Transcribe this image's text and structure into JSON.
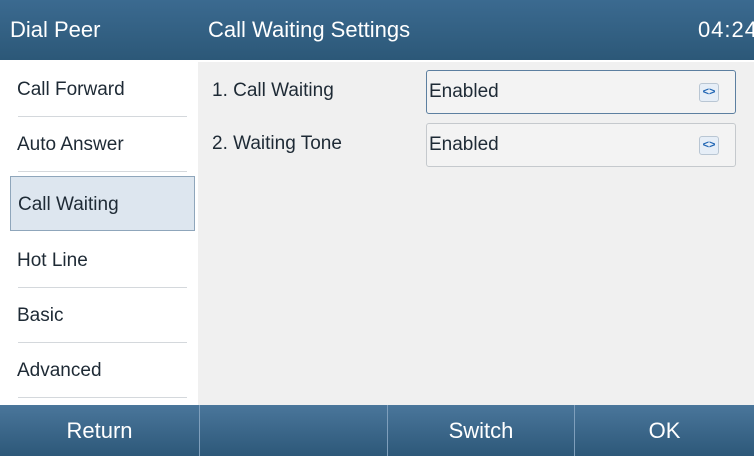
{
  "header": {
    "left_label": "Dial Peer",
    "title": "Call Waiting Settings",
    "time": "04:24"
  },
  "menu": {
    "items": [
      {
        "label": "Call Forward"
      },
      {
        "label": "Auto Answer"
      },
      {
        "label": "Call Waiting",
        "selected": true
      },
      {
        "label": "Hot Line"
      },
      {
        "label": "Basic"
      },
      {
        "label": "Advanced"
      }
    ]
  },
  "settings": [
    {
      "label": "1. Call Waiting",
      "value": "Enabled"
    },
    {
      "label": "2. Waiting Tone",
      "value": "Enabled"
    }
  ],
  "softkeys": {
    "return": "Return",
    "empty": "",
    "switch": "Switch",
    "ok": "OK"
  },
  "icons": {
    "selector_arrows": "<>"
  },
  "colors": {
    "header_bg": "#2f5b7c",
    "footer_bg": "#3a6689",
    "selected_item_bg": "#dde6ef",
    "content_bg": "#f0f0f0",
    "arrow_color": "#1f64b3"
  }
}
